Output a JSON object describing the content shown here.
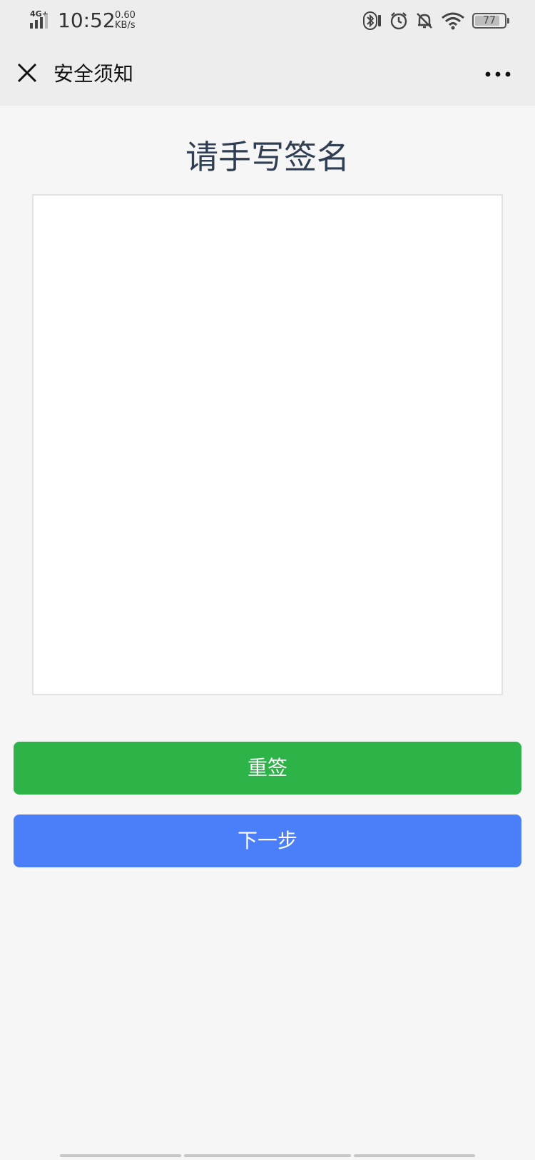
{
  "status_bar": {
    "network": "4G+",
    "time": "10:52",
    "speed_value": "0.60",
    "speed_unit": "KB/s",
    "battery": "77",
    "icons": [
      "bluetooth-icon",
      "alarm-icon",
      "mute-icon",
      "wifi-icon",
      "battery-icon"
    ]
  },
  "nav": {
    "title": "安全须知",
    "close_icon": "close-icon",
    "more_icon": "more-icon"
  },
  "main": {
    "heading": "请手写签名",
    "reset_label": "重签",
    "next_label": "下一步"
  },
  "colors": {
    "reset_button": "#2db348",
    "next_button": "#4b7ef9",
    "heading": "#2f3e52",
    "background": "#f6f6f6"
  }
}
